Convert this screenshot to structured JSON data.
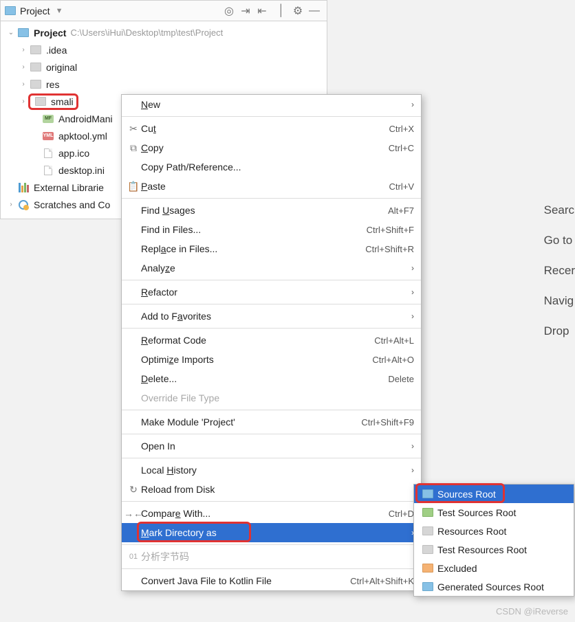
{
  "panel": {
    "title": "Project",
    "toolbar_icons": [
      "target-icon",
      "collapse-icon",
      "expand-icon",
      "settings-icon",
      "minimize-icon"
    ]
  },
  "tree": {
    "root": {
      "name": "Project",
      "path": "C:\\Users\\iHui\\Desktop\\tmp\\test\\Project"
    },
    "children": [
      {
        "name": ".idea",
        "type": "folder"
      },
      {
        "name": "original",
        "type": "folder"
      },
      {
        "name": "res",
        "type": "folder"
      },
      {
        "name": "smali",
        "type": "folder",
        "highlighted": true
      },
      {
        "name": "AndroidMani",
        "type": "mf"
      },
      {
        "name": "apktool.yml",
        "type": "yml"
      },
      {
        "name": "app.ico",
        "type": "file"
      },
      {
        "name": "desktop.ini",
        "type": "file"
      }
    ],
    "external": "External Librarie",
    "scratches": "Scratches and Co"
  },
  "menu": [
    {
      "label_html": "<u>N</u>ew",
      "submenu": true
    },
    {
      "sep": true
    },
    {
      "icon": "cut",
      "label_html": "Cu<u>t</u>",
      "shortcut": "Ctrl+X"
    },
    {
      "icon": "copy",
      "label_html": "<u>C</u>opy",
      "shortcut": "Ctrl+C"
    },
    {
      "label_html": "Copy Path/Reference..."
    },
    {
      "icon": "paste",
      "label_html": "<u>P</u>aste",
      "shortcut": "Ctrl+V"
    },
    {
      "sep": true
    },
    {
      "label_html": "Find <u>U</u>sages",
      "shortcut": "Alt+F7"
    },
    {
      "label_html": "Find in Files...",
      "shortcut": "Ctrl+Shift+F"
    },
    {
      "label_html": "Repl<u>a</u>ce in Files...",
      "shortcut": "Ctrl+Shift+R"
    },
    {
      "label_html": "Analy<u>z</u>e",
      "submenu": true
    },
    {
      "sep": true
    },
    {
      "label_html": "<u>R</u>efactor",
      "submenu": true
    },
    {
      "sep": true
    },
    {
      "label_html": "Add to F<u>a</u>vorites",
      "submenu": true
    },
    {
      "sep": true
    },
    {
      "label_html": "<u>R</u>eformat Code",
      "shortcut": "Ctrl+Alt+L"
    },
    {
      "label_html": "Optimi<u>z</u>e Imports",
      "shortcut": "Ctrl+Alt+O"
    },
    {
      "label_html": "<u>D</u>elete...",
      "shortcut": "Delete"
    },
    {
      "label_html": "Override File Type",
      "disabled": true
    },
    {
      "sep": true
    },
    {
      "label_html": "Make Module 'Project'",
      "shortcut": "Ctrl+Shift+F9"
    },
    {
      "sep": true
    },
    {
      "label_html": "Open In",
      "submenu": true
    },
    {
      "sep": true
    },
    {
      "label_html": "Local <u>H</u>istory",
      "submenu": true
    },
    {
      "icon": "reload",
      "label_html": "Reload from Disk"
    },
    {
      "sep": true
    },
    {
      "icon": "compare",
      "label_html": "Compar<u>e</u> With...",
      "shortcut": "Ctrl+D"
    },
    {
      "label_html": "<u>M</u>ark Directory as",
      "submenu": true,
      "selected": true
    },
    {
      "sep": true
    },
    {
      "icon": "num",
      "num": "01",
      "label_html": "分析字节码",
      "disabled": true
    },
    {
      "sep": true
    },
    {
      "label_html": "Convert Java File to Kotlin File",
      "shortcut": "Ctrl+Alt+Shift+K"
    }
  ],
  "submenu": [
    {
      "color": "blue",
      "label": "Sources Root",
      "selected": true,
      "highlighted": true
    },
    {
      "color": "green",
      "label": "Test Sources Root"
    },
    {
      "color": "plain",
      "label": "Resources Root"
    },
    {
      "color": "plain-test",
      "label": "Test Resources Root"
    },
    {
      "color": "orange",
      "label": "Excluded"
    },
    {
      "color": "blue",
      "label": "Generated Sources Root"
    }
  ],
  "hints": [
    "Searc",
    "Go to",
    "Recer",
    "Navig",
    "Drop"
  ],
  "watermark": "CSDN @iReverse"
}
